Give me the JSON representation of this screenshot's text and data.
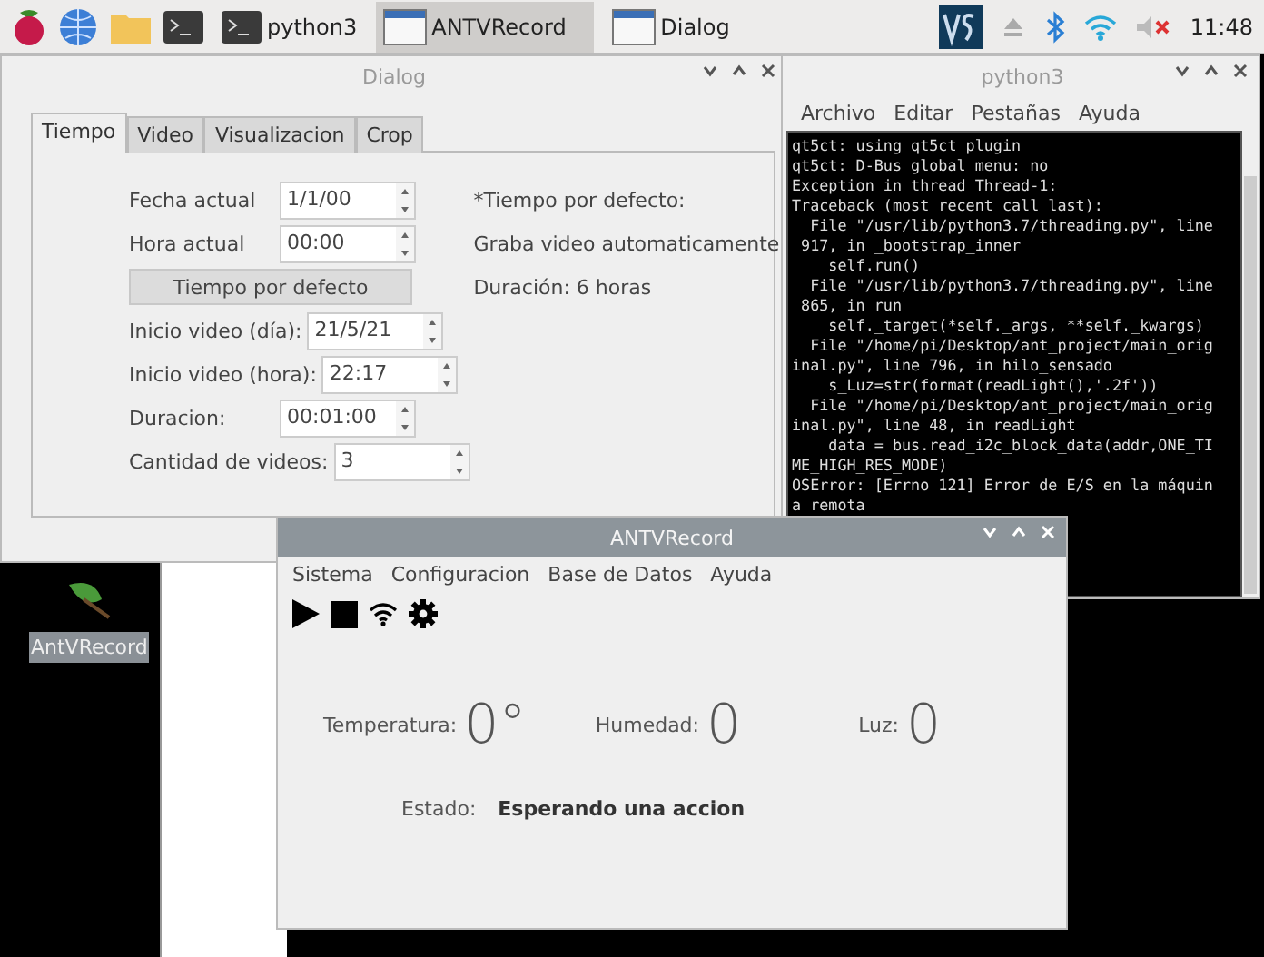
{
  "taskbar": {
    "tasks": [
      {
        "label": "python3",
        "kind": "terminal",
        "selected": false
      },
      {
        "label": "ANTVRecord",
        "kind": "window",
        "selected": true
      },
      {
        "label": "Dialog",
        "kind": "window",
        "selected": false
      }
    ],
    "clock": "11:48"
  },
  "desktop_icon": {
    "label": "AntVRecord"
  },
  "dialog": {
    "title": "Dialog",
    "tabs": [
      {
        "label": "Tiempo",
        "selected": true
      },
      {
        "label": "Video",
        "selected": false
      },
      {
        "label": "Visualizacion",
        "selected": false
      },
      {
        "label": "Crop",
        "selected": false
      }
    ],
    "rows": [
      {
        "kind": "spin",
        "label": "Fecha actual",
        "value": "1/1/00"
      },
      {
        "kind": "spin",
        "label": "Hora actual",
        "value": "00:00"
      },
      {
        "kind": "button",
        "label": "Tiempo por defecto"
      },
      {
        "kind": "spin",
        "label": "Inicio video (día):",
        "value": "21/5/21"
      },
      {
        "kind": "spin",
        "label": "Inicio video (hora):",
        "value": "22:17"
      },
      {
        "kind": "spin",
        "label": "Duracion:",
        "value": "00:01:00"
      },
      {
        "kind": "spin",
        "label": "Cantidad de videos:",
        "value": "3"
      }
    ],
    "notes": [
      "*Tiempo por defecto:",
      "Graba video automaticamente",
      "Duración: 6 horas"
    ]
  },
  "terminal": {
    "title": "python3",
    "menu": [
      "Archivo",
      "Editar",
      "Pestañas",
      "Ayuda"
    ],
    "lines": [
      "qt5ct: using qt5ct plugin",
      "qt5ct: D-Bus global menu: no",
      "Exception in thread Thread-1:",
      "Traceback (most recent call last):",
      "  File \"/usr/lib/python3.7/threading.py\", line",
      " 917, in _bootstrap_inner",
      "    self.run()",
      "  File \"/usr/lib/python3.7/threading.py\", line",
      " 865, in run",
      "    self._target(*self._args, **self._kwargs)",
      "  File \"/home/pi/Desktop/ant_project/main_orig",
      "inal.py\", line 796, in hilo_sensado",
      "    s_Luz=str(format(readLight(),'.2f'))",
      "  File \"/home/pi/Desktop/ant_project/main_orig",
      "inal.py\", line 48, in readLight",
      "    data = bus.read_i2c_block_data(addr,ONE_TI",
      "ME_HIGH_RES_MODE)",
      "OSError: [Errno 121] Error de E/S en la máquin",
      "a remota"
    ]
  },
  "antv": {
    "title": "ANTVRecord",
    "menu": [
      "Sistema",
      "Configuracion",
      "Base de Datos",
      "Ayuda"
    ],
    "readings": [
      {
        "label": "Temperatura:",
        "value": "0°"
      },
      {
        "label": "Humedad:",
        "value": "0"
      },
      {
        "label": "Luz:",
        "value": "0"
      }
    ],
    "status_label": "Estado:",
    "status_value": "Esperando una accion"
  }
}
